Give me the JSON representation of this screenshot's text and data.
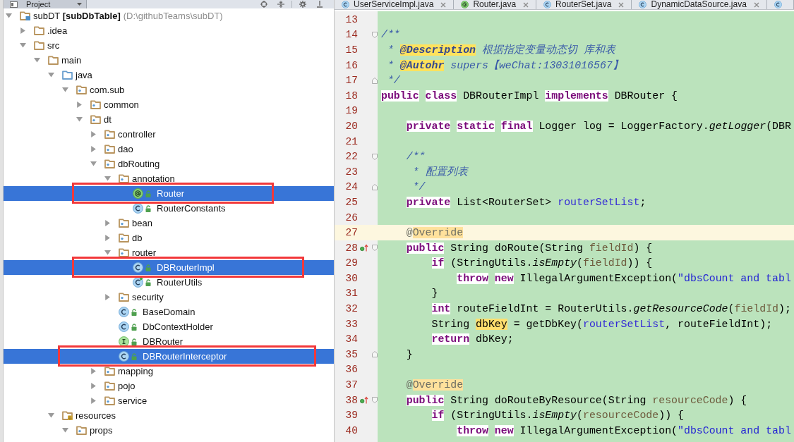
{
  "tool_window": {
    "title": "Project"
  },
  "tree": [
    {
      "name": "subDT **[subDbTable]**",
      "path": "(D:\\githubTeams\\subDT)",
      "kind": "module",
      "expanded": true,
      "selected": false,
      "outlined": false,
      "children": [
        {
          "name": ".idea",
          "kind": "folder",
          "expanded": false,
          "selected": false,
          "outlined": false
        },
        {
          "name": "src",
          "kind": "folder",
          "expanded": true,
          "selected": false,
          "outlined": false,
          "children": [
            {
              "name": "main",
              "kind": "folder",
              "expanded": true,
              "selected": false,
              "outlined": false,
              "children": [
                {
                  "name": "java",
                  "kind": "source-root",
                  "expanded": true,
                  "selected": false,
                  "outlined": false,
                  "children": [
                    {
                      "name": "com.sub",
                      "kind": "package",
                      "expanded": true,
                      "selected": false,
                      "outlined": false,
                      "children": [
                        {
                          "name": "common",
                          "kind": "package",
                          "expanded": false,
                          "selected": false,
                          "outlined": false
                        },
                        {
                          "name": "dt",
                          "kind": "package",
                          "expanded": true,
                          "selected": false,
                          "outlined": false,
                          "children": [
                            {
                              "name": "controller",
                              "kind": "package",
                              "expanded": false,
                              "selected": false,
                              "outlined": false
                            },
                            {
                              "name": "dao",
                              "kind": "package",
                              "expanded": false,
                              "selected": false,
                              "outlined": false
                            },
                            {
                              "name": "dbRouting",
                              "kind": "package",
                              "expanded": true,
                              "selected": false,
                              "outlined": false,
                              "children": [
                                {
                                  "name": "annotation",
                                  "kind": "package",
                                  "expanded": true,
                                  "selected": false,
                                  "outlined": false,
                                  "children": [
                                    {
                                      "name": "Router",
                                      "kind": "annotation",
                                      "selected": true,
                                      "outlined": true
                                    },
                                    {
                                      "name": "RouterConstants",
                                      "kind": "class",
                                      "selected": false,
                                      "outlined": false
                                    }
                                  ]
                                },
                                {
                                  "name": "bean",
                                  "kind": "package",
                                  "expanded": false,
                                  "selected": false,
                                  "outlined": false
                                },
                                {
                                  "name": "db",
                                  "kind": "package",
                                  "expanded": false,
                                  "selected": false,
                                  "outlined": false
                                },
                                {
                                  "name": "router",
                                  "kind": "package",
                                  "expanded": true,
                                  "selected": false,
                                  "outlined": false,
                                  "children": [
                                    {
                                      "name": "DBRouterImpl",
                                      "kind": "class",
                                      "selected": true,
                                      "outlined": true
                                    },
                                    {
                                      "name": "RouterUtils",
                                      "kind": "main-class",
                                      "selected": false,
                                      "outlined": false
                                    }
                                  ]
                                },
                                {
                                  "name": "security",
                                  "kind": "package",
                                  "expanded": false,
                                  "selected": false,
                                  "outlined": false
                                },
                                {
                                  "name": "BaseDomain",
                                  "kind": "class",
                                  "selected": false,
                                  "outlined": false
                                },
                                {
                                  "name": "DbContextHolder",
                                  "kind": "class",
                                  "selected": false,
                                  "outlined": false
                                },
                                {
                                  "name": "DBRouter",
                                  "kind": "interface",
                                  "selected": false,
                                  "outlined": false
                                },
                                {
                                  "name": "DBRouterInterceptor",
                                  "kind": "class",
                                  "selected": true,
                                  "outlined": true
                                }
                              ]
                            },
                            {
                              "name": "mapping",
                              "kind": "package",
                              "expanded": false,
                              "selected": false,
                              "outlined": false
                            },
                            {
                              "name": "pojo",
                              "kind": "package",
                              "expanded": false,
                              "selected": false,
                              "outlined": false
                            },
                            {
                              "name": "service",
                              "kind": "package",
                              "expanded": false,
                              "selected": false,
                              "outlined": false
                            }
                          ]
                        }
                      ]
                    }
                  ]
                },
                {
                  "name": "resources",
                  "kind": "resources",
                  "expanded": true,
                  "selected": false,
                  "outlined": false,
                  "children": [
                    {
                      "name": "props",
                      "kind": "package",
                      "expanded": true,
                      "selected": false,
                      "outlined": false
                    }
                  ]
                }
              ]
            }
          ]
        }
      ]
    }
  ],
  "editor_tabs": [
    {
      "label": "UserServiceImpl.java",
      "kind": "class",
      "selected": false
    },
    {
      "label": "Router.java",
      "kind": "annotation",
      "selected": false
    },
    {
      "label": "RouterSet.java",
      "kind": "class",
      "selected": false
    },
    {
      "label": "DynamicDataSource.java",
      "kind": "class",
      "selected": false
    },
    {
      "kind": "class",
      "selected": false
    }
  ],
  "editor": {
    "lines": [
      {
        "number": "13",
        "current": false
      },
      {
        "number": "14",
        "current": false,
        "gutter": [
          {
            "kind": "fold-start"
          }
        ],
        "tokens": [
          {
            "text": "/**",
            "kind": "doc"
          }
        ]
      },
      {
        "number": "15",
        "current": false,
        "tokens": [
          {
            "text": " * ",
            "kind": "doc"
          },
          {
            "text": "@Description",
            "kind": "doc-tag"
          },
          {
            "text": " 根据指定变量动态切 库和表",
            "kind": "doc"
          }
        ]
      },
      {
        "number": "16",
        "current": false,
        "tokens": [
          {
            "text": " * ",
            "kind": "doc"
          },
          {
            "text": "@Autohr",
            "kind": "doc-tag"
          },
          {
            "text": " supers【weChat:13031016567】",
            "kind": "doc"
          }
        ]
      },
      {
        "number": "17",
        "current": false,
        "gutter": [
          {
            "kind": "fold-end"
          }
        ],
        "tokens": [
          {
            "text": " */",
            "kind": "doc"
          }
        ]
      },
      {
        "number": "18",
        "current": false,
        "tokens": [
          {
            "text": "public",
            "kind": "keyword"
          },
          {
            "text": " class",
            "kind": "keyword"
          },
          {
            "text": " DBRouterImpl ",
            "kind": "plain"
          },
          {
            "text": "implements",
            "kind": "keyword"
          },
          {
            "text": " DBRouter {",
            "kind": "plain"
          }
        ]
      },
      {
        "number": "19",
        "current": false
      },
      {
        "number": "20",
        "current": false,
        "tokens": [
          {
            "text": "    private",
            "kind": "keyword"
          },
          {
            "text": " static",
            "kind": "keyword"
          },
          {
            "text": " final",
            "kind": "keyword"
          },
          {
            "text": " Logger log = LoggerFactory.",
            "kind": "plain"
          },
          {
            "text": "getLogger",
            "kind": "static-call"
          },
          {
            "text": "(DBR",
            "kind": "plain"
          }
        ]
      },
      {
        "number": "21",
        "current": false
      },
      {
        "number": "22",
        "current": false,
        "gutter": [
          {
            "kind": "fold-start"
          }
        ],
        "tokens": [
          {
            "text": "    /**",
            "kind": "doc"
          }
        ]
      },
      {
        "number": "23",
        "current": false,
        "tokens": [
          {
            "text": "     * 配置列表",
            "kind": "doc"
          }
        ]
      },
      {
        "number": "24",
        "current": false,
        "gutter": [
          {
            "kind": "fold-end"
          }
        ],
        "tokens": [
          {
            "text": "     */",
            "kind": "doc"
          }
        ]
      },
      {
        "number": "25",
        "current": false,
        "tokens": [
          {
            "text": "    private",
            "kind": "keyword"
          },
          {
            "text": " List<RouterSet> ",
            "kind": "plain"
          },
          {
            "text": "routerSetList",
            "kind": "field"
          },
          {
            "text": ";",
            "kind": "plain"
          }
        ]
      },
      {
        "number": "26",
        "current": false
      },
      {
        "number": "27",
        "current": true,
        "tokens": [
          {
            "text": "    @",
            "kind": "annotation"
          },
          {
            "text": "Override",
            "kind": "annotation-usage"
          }
        ]
      },
      {
        "number": "28",
        "current": false,
        "gutter": [
          {
            "kind": "override"
          },
          {
            "kind": "fold-start"
          }
        ],
        "tokens": [
          {
            "text": "    public",
            "kind": "keyword"
          },
          {
            "text": " String doRoute(String ",
            "kind": "plain"
          },
          {
            "text": "fieldId",
            "kind": "param"
          },
          {
            "text": ") {",
            "kind": "plain"
          }
        ]
      },
      {
        "number": "29",
        "current": false,
        "tokens": [
          {
            "text": "        if",
            "kind": "keyword"
          },
          {
            "text": " (StringUtils.",
            "kind": "plain"
          },
          {
            "text": "isEmpty",
            "kind": "static-call"
          },
          {
            "text": "(",
            "kind": "plain"
          },
          {
            "text": "fieldId",
            "kind": "param"
          },
          {
            "text": ")) {",
            "kind": "plain"
          }
        ]
      },
      {
        "number": "30",
        "current": false,
        "tokens": [
          {
            "text": "            throw",
            "kind": "keyword"
          },
          {
            "text": " new",
            "kind": "keyword"
          },
          {
            "text": " IllegalArgumentException(",
            "kind": "plain"
          },
          {
            "text": "\"dbsCount and tabl",
            "kind": "string"
          }
        ]
      },
      {
        "number": "31",
        "current": false,
        "tokens": [
          {
            "text": "        }",
            "kind": "plain"
          }
        ]
      },
      {
        "number": "32",
        "current": false,
        "tokens": [
          {
            "text": "        int",
            "kind": "keyword"
          },
          {
            "text": " routeFieldInt = RouterUtils.",
            "kind": "plain"
          },
          {
            "text": "getResourceCode",
            "kind": "static-call"
          },
          {
            "text": "(",
            "kind": "plain"
          },
          {
            "text": "fieldId",
            "kind": "param"
          },
          {
            "text": ");",
            "kind": "plain"
          }
        ]
      },
      {
        "number": "33",
        "current": false,
        "tokens": [
          {
            "text": "        String ",
            "kind": "plain"
          },
          {
            "text": "dbKey",
            "kind": "usage"
          },
          {
            "text": " = getDbKey(",
            "kind": "plain"
          },
          {
            "text": "routerSetList",
            "kind": "field"
          },
          {
            "text": ", routeFieldInt);",
            "kind": "plain"
          }
        ]
      },
      {
        "number": "34",
        "current": false,
        "tokens": [
          {
            "text": "        return",
            "kind": "keyword"
          },
          {
            "text": " dbKey;",
            "kind": "plain"
          }
        ]
      },
      {
        "number": "35",
        "current": false,
        "gutter": [
          {
            "kind": "fold-end"
          }
        ],
        "tokens": [
          {
            "text": "    }",
            "kind": "plain"
          }
        ]
      },
      {
        "number": "36",
        "current": false
      },
      {
        "number": "37",
        "current": false,
        "tokens": [
          {
            "text": "    @",
            "kind": "annotation"
          },
          {
            "text": "Override",
            "kind": "annotation-usage"
          }
        ]
      },
      {
        "number": "38",
        "current": false,
        "gutter": [
          {
            "kind": "override"
          },
          {
            "kind": "fold-start"
          }
        ],
        "tokens": [
          {
            "text": "    public",
            "kind": "keyword"
          },
          {
            "text": " String doRouteByResource(String ",
            "kind": "plain"
          },
          {
            "text": "resourceCode",
            "kind": "param"
          },
          {
            "text": ") {",
            "kind": "plain"
          }
        ]
      },
      {
        "number": "39",
        "current": false,
        "tokens": [
          {
            "text": "        if",
            "kind": "keyword"
          },
          {
            "text": " (StringUtils.",
            "kind": "plain"
          },
          {
            "text": "isEmpty",
            "kind": "static-call"
          },
          {
            "text": "(",
            "kind": "plain"
          },
          {
            "text": "resourceCode",
            "kind": "param"
          },
          {
            "text": ")) {",
            "kind": "plain"
          }
        ]
      },
      {
        "number": "40",
        "current": false,
        "tokens": [
          {
            "text": "            throw",
            "kind": "keyword"
          },
          {
            "text": " new",
            "kind": "keyword"
          },
          {
            "text": " IllegalArgumentException(",
            "kind": "plain"
          },
          {
            "text": "\"dbsCount and tabl",
            "kind": "string"
          }
        ]
      }
    ]
  }
}
